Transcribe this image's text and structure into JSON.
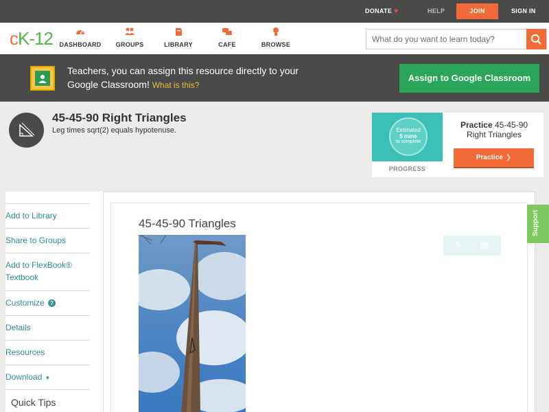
{
  "topbar": {
    "donate": "DONATE",
    "help": "HELP",
    "join": "JOIN",
    "signin": "SIGN IN"
  },
  "logo": {
    "c": "c",
    "k": "K",
    "n": "-12"
  },
  "nav": {
    "items": [
      {
        "label": "DASHBOARD",
        "icon": "dashboard-icon"
      },
      {
        "label": "GROUPS",
        "icon": "groups-icon"
      },
      {
        "label": "LIBRARY",
        "icon": "library-icon"
      },
      {
        "label": "CAFE",
        "icon": "cafe-icon"
      },
      {
        "label": "BROWSE",
        "icon": "browse-icon"
      }
    ]
  },
  "search": {
    "placeholder": "What do you want to learn today?"
  },
  "banner": {
    "message": "Teachers, you can assign this resource directly to your Google Classroom!",
    "what_is_this": "What is this?",
    "assign_label": "Assign to Google Classroom"
  },
  "concept": {
    "title": "45-45-90 Right Triangles",
    "subtitle": "Leg times sqrt(2) equals hypotenuse."
  },
  "practice": {
    "badge_line1": "Estimated",
    "badge_line2": "5 mins",
    "badge_line3": "to complete",
    "progress_label": "PROGRESS",
    "heading_bold": "Practice",
    "heading_rest": "45-45-90 Right Triangles",
    "button_label": "Practice"
  },
  "sidebar": {
    "items": [
      {
        "label": "Add to Library"
      },
      {
        "label": "Share to Groups"
      },
      {
        "label": "Add to FlexBook® Textbook"
      },
      {
        "label": "Customize"
      },
      {
        "label": "Details"
      },
      {
        "label": "Resources"
      },
      {
        "label": "Download"
      }
    ],
    "customize_help": "?",
    "quick_tips": "Quick Tips"
  },
  "main": {
    "title": "45-45-90 Triangles"
  },
  "support": "Support",
  "colors": {
    "accent_orange": "#f26a37",
    "brand_green": "#50b848",
    "classroom_green": "#2aa55a",
    "link_teal": "#2e8b94",
    "dark_bar": "#4a4a48"
  }
}
